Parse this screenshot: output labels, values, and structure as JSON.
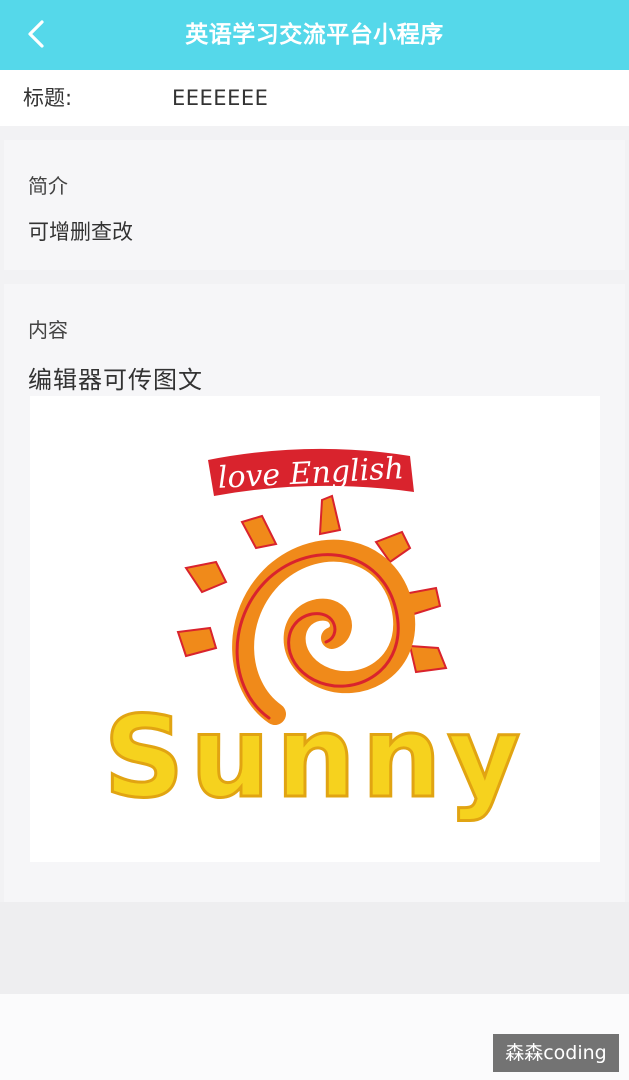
{
  "navbar": {
    "title": "英语学习交流平台小程序",
    "back_icon": "chevron-left-icon",
    "color": "#55d8ea"
  },
  "title_row": {
    "label": "标题:",
    "value": "EEEEEEE"
  },
  "summary": {
    "label": "简介",
    "text": "可增删查改"
  },
  "content": {
    "label": "内容",
    "text": "编辑器可传图文",
    "image": {
      "banner_text": "love English",
      "logo_text": "Sunny",
      "banner_color": "#d9232d",
      "sun_color": "#f08a1a",
      "text_color": "#f6d21e"
    }
  },
  "watermark": "森森coding"
}
